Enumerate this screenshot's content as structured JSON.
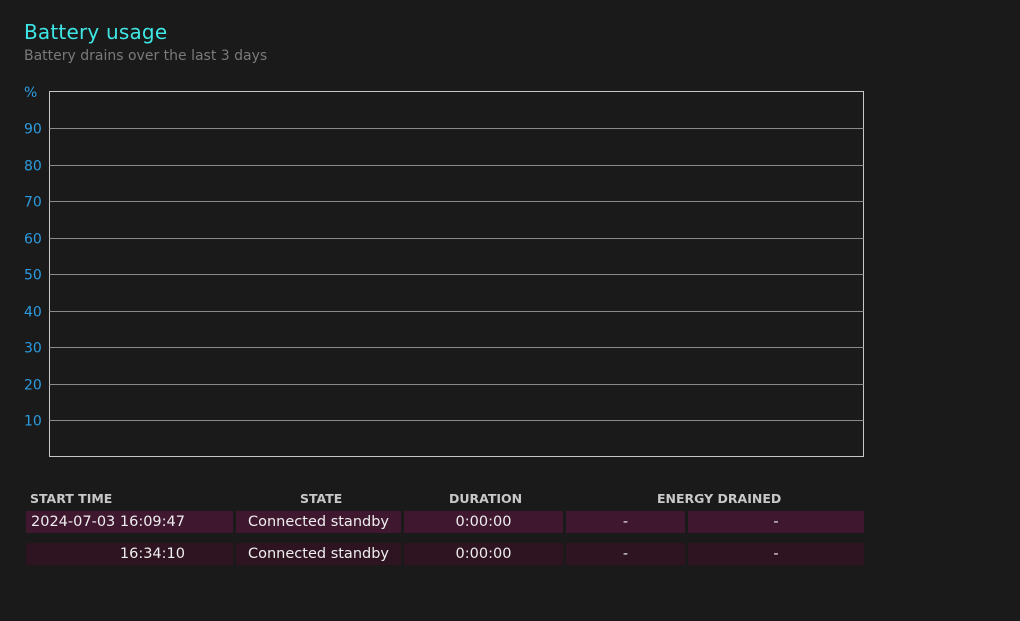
{
  "header": {
    "title": "Battery usage",
    "subtitle": "Battery drains over the last 3 days"
  },
  "chart_data": {
    "type": "area",
    "title": "",
    "xlabel": "",
    "ylabel": "%",
    "ylim": [
      0,
      100
    ],
    "yticks": [
      10,
      20,
      30,
      40,
      50,
      60,
      70,
      80,
      90
    ],
    "grid": true,
    "series": [],
    "colors": {
      "tick_label": "#2c9ce0",
      "gridline": "#8a8a8a",
      "frame": "#c8c8c8"
    }
  },
  "table": {
    "columns": {
      "start_time": "START TIME",
      "state": "STATE",
      "duration": "DURATION",
      "energy_drained": "ENERGY DRAINED"
    },
    "rows": [
      {
        "date": "2024-07-03",
        "time": "16:09:47",
        "state": "Connected standby",
        "duration": "0:00:00",
        "energy_pct": "-",
        "energy_mwh": "-"
      },
      {
        "date": "",
        "time": "16:34:10",
        "state": "Connected standby",
        "duration": "0:00:00",
        "energy_pct": "-",
        "energy_mwh": "-"
      }
    ]
  }
}
